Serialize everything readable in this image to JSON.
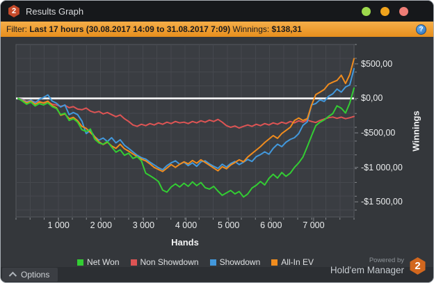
{
  "window": {
    "title": "Results Graph",
    "logo_badge": "2",
    "controls": [
      {
        "name": "minimize",
        "color": "#9dd94c"
      },
      {
        "name": "maximize",
        "color": "#f0a31c"
      },
      {
        "name": "close",
        "color": "#ee7d76"
      }
    ]
  },
  "filter_bar": {
    "label": "Filter: ",
    "filter_text": "Last 17 hours (30.08.2017 14:09 to 31.08.2017 7:09)",
    "winnings_label": " Winnings: ",
    "winnings_value": "$138,31",
    "info_icon_glyph": "?"
  },
  "chart_data": {
    "type": "line",
    "title": "",
    "xlabel": "Hands",
    "ylabel": "Winnings",
    "xlim": [
      0,
      7950
    ],
    "ylim": [
      -1719,
      781
    ],
    "grid": true,
    "zero_line": true,
    "zero_line_color": "#ffffff",
    "legend_position": "bottom",
    "plot_bg": "#3a3d42",
    "grid_color": "#45484e",
    "border_color": "#56595f",
    "tick_color": "#85888d",
    "x_ticks": [
      {
        "value": 1000,
        "label": "1 000"
      },
      {
        "value": 2000,
        "label": "2 000"
      },
      {
        "value": 3000,
        "label": "3 000"
      },
      {
        "value": 4000,
        "label": "4 000"
      },
      {
        "value": 5000,
        "label": "5 000"
      },
      {
        "value": 6000,
        "label": "6 000"
      },
      {
        "value": 7000,
        "label": "7 000"
      }
    ],
    "y_ticks": [
      {
        "value": 500,
        "label": "$500,00"
      },
      {
        "value": 0,
        "label": "$0,00"
      },
      {
        "value": -500,
        "label": "-$500,00"
      },
      {
        "value": -1000,
        "label": "-$1 000,00"
      },
      {
        "value": -1500,
        "label": "-$1 500,00"
      }
    ],
    "x_start": 50,
    "x_step": 100,
    "draw_order": [
      1,
      2,
      3,
      0
    ],
    "series": [
      {
        "name": "Net Won",
        "color": "#33cd33",
        "values": [
          0,
          -40,
          -85,
          -55,
          -110,
          -75,
          -95,
          -65,
          -120,
          -145,
          -235,
          -215,
          -320,
          -295,
          -345,
          -455,
          -480,
          -445,
          -590,
          -645,
          -665,
          -625,
          -705,
          -780,
          -745,
          -825,
          -795,
          -870,
          -845,
          -905,
          -1085,
          -1120,
          -1160,
          -1205,
          -1330,
          -1360,
          -1285,
          -1240,
          -1285,
          -1230,
          -1275,
          -1210,
          -1265,
          -1220,
          -1295,
          -1315,
          -1275,
          -1345,
          -1405,
          -1370,
          -1335,
          -1385,
          -1350,
          -1430,
          -1385,
          -1300,
          -1260,
          -1205,
          -1255,
          -1160,
          -1100,
          -1155,
          -1075,
          -1130,
          -1085,
          -1000,
          -935,
          -850,
          -700,
          -545,
          -395,
          -345,
          -312,
          -262,
          -222,
          -108,
          -142,
          -212,
          -68,
          150
        ]
      },
      {
        "name": "Non Showdown",
        "color": "#dd5454",
        "values": [
          0,
          -15,
          -45,
          -30,
          -55,
          -45,
          -70,
          -50,
          -85,
          -95,
          -115,
          -100,
          -135,
          -120,
          -155,
          -165,
          -140,
          -185,
          -205,
          -190,
          -225,
          -205,
          -235,
          -265,
          -240,
          -295,
          -335,
          -385,
          -405,
          -375,
          -395,
          -365,
          -385,
          -355,
          -375,
          -345,
          -365,
          -335,
          -355,
          -345,
          -365,
          -335,
          -355,
          -325,
          -345,
          -315,
          -335,
          -305,
          -345,
          -395,
          -420,
          -400,
          -430,
          -405,
          -385,
          -405,
          -375,
          -395,
          -365,
          -385,
          -355,
          -375,
          -345,
          -365,
          -335,
          -355,
          -325,
          -345,
          -315,
          -335,
          -350,
          -320,
          -300,
          -280,
          -270,
          -290,
          -272,
          -295,
          -280,
          -262
        ]
      },
      {
        "name": "Showdown",
        "color": "#4298dc",
        "values": [
          0,
          -20,
          -55,
          -25,
          -65,
          -15,
          15,
          50,
          -40,
          -70,
          -125,
          -95,
          -235,
          -205,
          -235,
          -330,
          -510,
          -465,
          -555,
          -605,
          -575,
          -625,
          -570,
          -645,
          -600,
          -680,
          -725,
          -775,
          -825,
          -860,
          -880,
          -925,
          -965,
          -1005,
          -1035,
          -975,
          -935,
          -905,
          -955,
          -925,
          -975,
          -935,
          -985,
          -920,
          -905,
          -950,
          -985,
          -1015,
          -955,
          -995,
          -945,
          -915,
          -960,
          -925,
          -885,
          -915,
          -845,
          -815,
          -775,
          -810,
          -725,
          -665,
          -700,
          -635,
          -595,
          -570,
          -510,
          -390,
          -340,
          -95,
          -75,
          -20,
          -45,
          30,
          65,
          135,
          90,
          165,
          195,
          430
        ]
      },
      {
        "name": "All-In EV",
        "color": "#f08c1e",
        "values": [
          0,
          -30,
          -65,
          -40,
          -85,
          -55,
          -65,
          -40,
          -105,
          -135,
          -245,
          -225,
          -295,
          -275,
          -325,
          -405,
          -435,
          -495,
          -555,
          -630,
          -670,
          -635,
          -690,
          -725,
          -665,
          -730,
          -765,
          -805,
          -845,
          -880,
          -905,
          -950,
          -1000,
          -1030,
          -1060,
          -1010,
          -960,
          -1000,
          -955,
          -920,
          -950,
          -900,
          -940,
          -890,
          -930,
          -970,
          -1010,
          -1050,
          -990,
          -1020,
          -965,
          -930,
          -890,
          -920,
          -850,
          -800,
          -750,
          -700,
          -640,
          -590,
          -540,
          -580,
          -510,
          -465,
          -420,
          -320,
          -285,
          -320,
          -295,
          -100,
          55,
          90,
          130,
          205,
          235,
          260,
          335,
          215,
          345,
          575
        ]
      }
    ]
  },
  "footer": {
    "options_label": "Options",
    "powered_by_line1": "Powered by",
    "powered_by_line2": "Hold'em Manager",
    "brand_badge": "2"
  }
}
